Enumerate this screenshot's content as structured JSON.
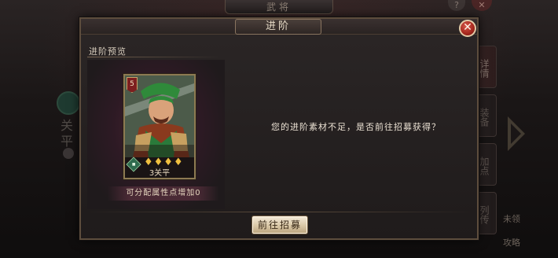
{
  "background": {
    "title": "武将",
    "help_glyph": "?",
    "close_glyph": "✕",
    "hero_name": "关平",
    "side_tabs": [
      "详情",
      "装备",
      "加点",
      "列传"
    ],
    "bottom_labels": [
      "未领",
      "攻略"
    ]
  },
  "dialog": {
    "title": "进阶",
    "close_glyph": "✕",
    "preview_label": "进阶预览",
    "card": {
      "level": "5",
      "stars": "♦♦♦♦",
      "star_count": 4,
      "name": "3关平"
    },
    "attr_text": "可分配属性点增加0",
    "message": "您的进阶素材不足，是否前往招募获得？",
    "button_label": "前往招募"
  },
  "colors": {
    "accent_gold": "#8d7a52",
    "close_red": "#a3261c",
    "button_face": "#d9c7a6",
    "panel_magenta": "#4a2332"
  }
}
